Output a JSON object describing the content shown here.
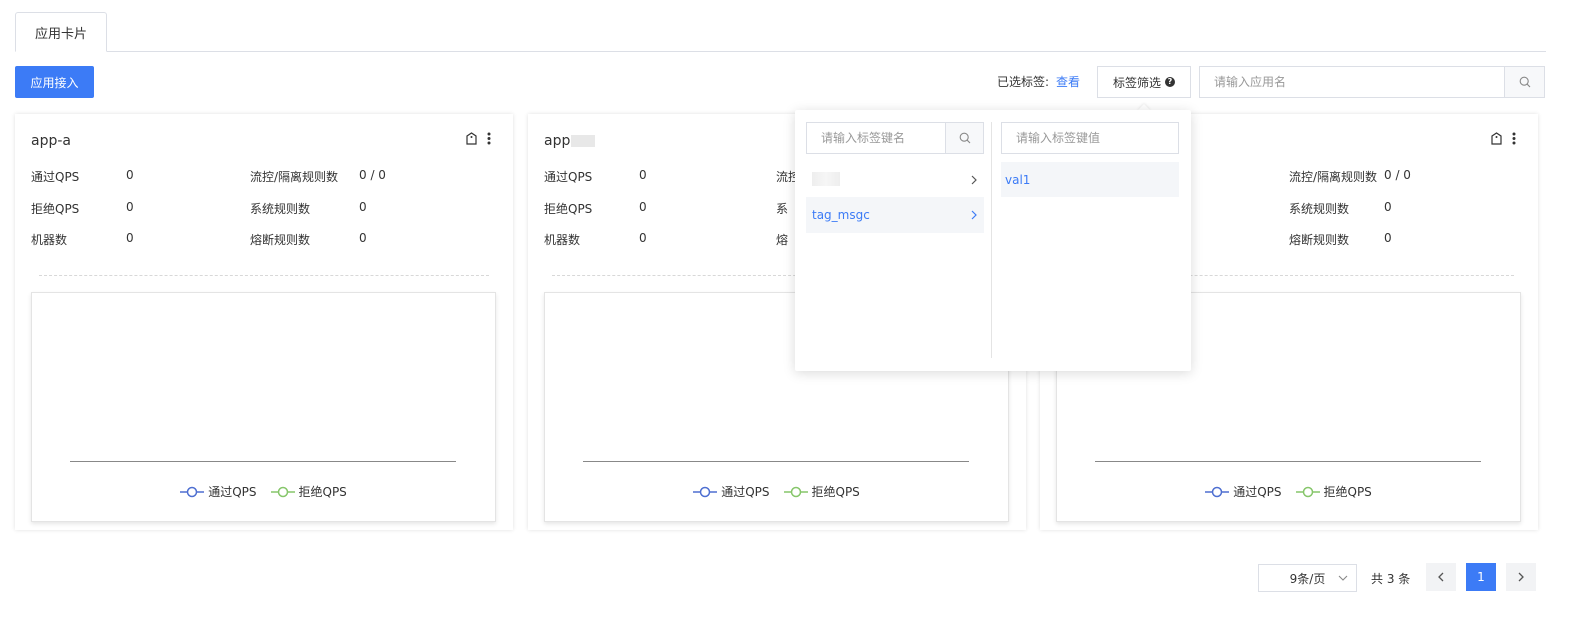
{
  "tabs": [
    {
      "label": "应用卡片"
    }
  ],
  "toolbar": {
    "add_app_label": "应用接入",
    "selected_tags_label": "已选标签:",
    "view_link": "查看",
    "tag_filter_label": "标签筛选",
    "app_search_placeholder": "请输入应用名"
  },
  "cards": [
    {
      "title": "app-a",
      "metrics": [
        {
          "label": "通过QPS",
          "value": "0"
        },
        {
          "label": "流控/隔离规则数",
          "value": "0 / 0"
        },
        {
          "label": "拒绝QPS",
          "value": "0"
        },
        {
          "label": "系统规则数",
          "value": "0"
        },
        {
          "label": "机器数",
          "value": "0"
        },
        {
          "label": "熔断规则数",
          "value": "0"
        }
      ],
      "legend": [
        "通过QPS",
        "拒绝QPS"
      ]
    },
    {
      "title": "app",
      "metrics": [
        {
          "label": "通过QPS",
          "value": "0"
        },
        {
          "label": "流控",
          "value": ""
        },
        {
          "label": "拒绝QPS",
          "value": "0"
        },
        {
          "label": "系",
          "value": ""
        },
        {
          "label": "机器数",
          "value": "0"
        },
        {
          "label": "熔",
          "value": ""
        }
      ],
      "legend": [
        "通过QPS",
        "拒绝QPS"
      ]
    },
    {
      "title": "",
      "metrics": [
        {
          "label": "",
          "value": ""
        },
        {
          "label": "流控/隔离规则数",
          "value": "0 / 0"
        },
        {
          "label": "",
          "value": ""
        },
        {
          "label": "系统规则数",
          "value": "0"
        },
        {
          "label": "",
          "value": ""
        },
        {
          "label": "熔断规则数",
          "value": "0"
        }
      ],
      "legend": [
        "通过QPS",
        "拒绝QPS"
      ]
    }
  ],
  "popover": {
    "key_search_placeholder": "请输入标签键名",
    "value_search_placeholder": "请输入标签键值",
    "keys": [
      {
        "label": "",
        "active": false
      },
      {
        "label": "tag_msgc",
        "active": true
      }
    ],
    "values": [
      {
        "label": "val1"
      }
    ]
  },
  "pagination": {
    "page_size": "9条/页",
    "total": "共 3 条",
    "current_page": "1"
  },
  "colors": {
    "primary": "#3c7bf6",
    "pass_qps": "#4e6fd1",
    "reject_qps": "#86c66a"
  },
  "icons": {
    "tag": "tag-icon",
    "more": "more-vertical-icon",
    "search": "search-icon",
    "help": "question-circle-icon",
    "chevron_right": "chevron-right-icon",
    "chevron_left": "chevron-left-icon",
    "chevron_down": "chevron-down-icon"
  }
}
